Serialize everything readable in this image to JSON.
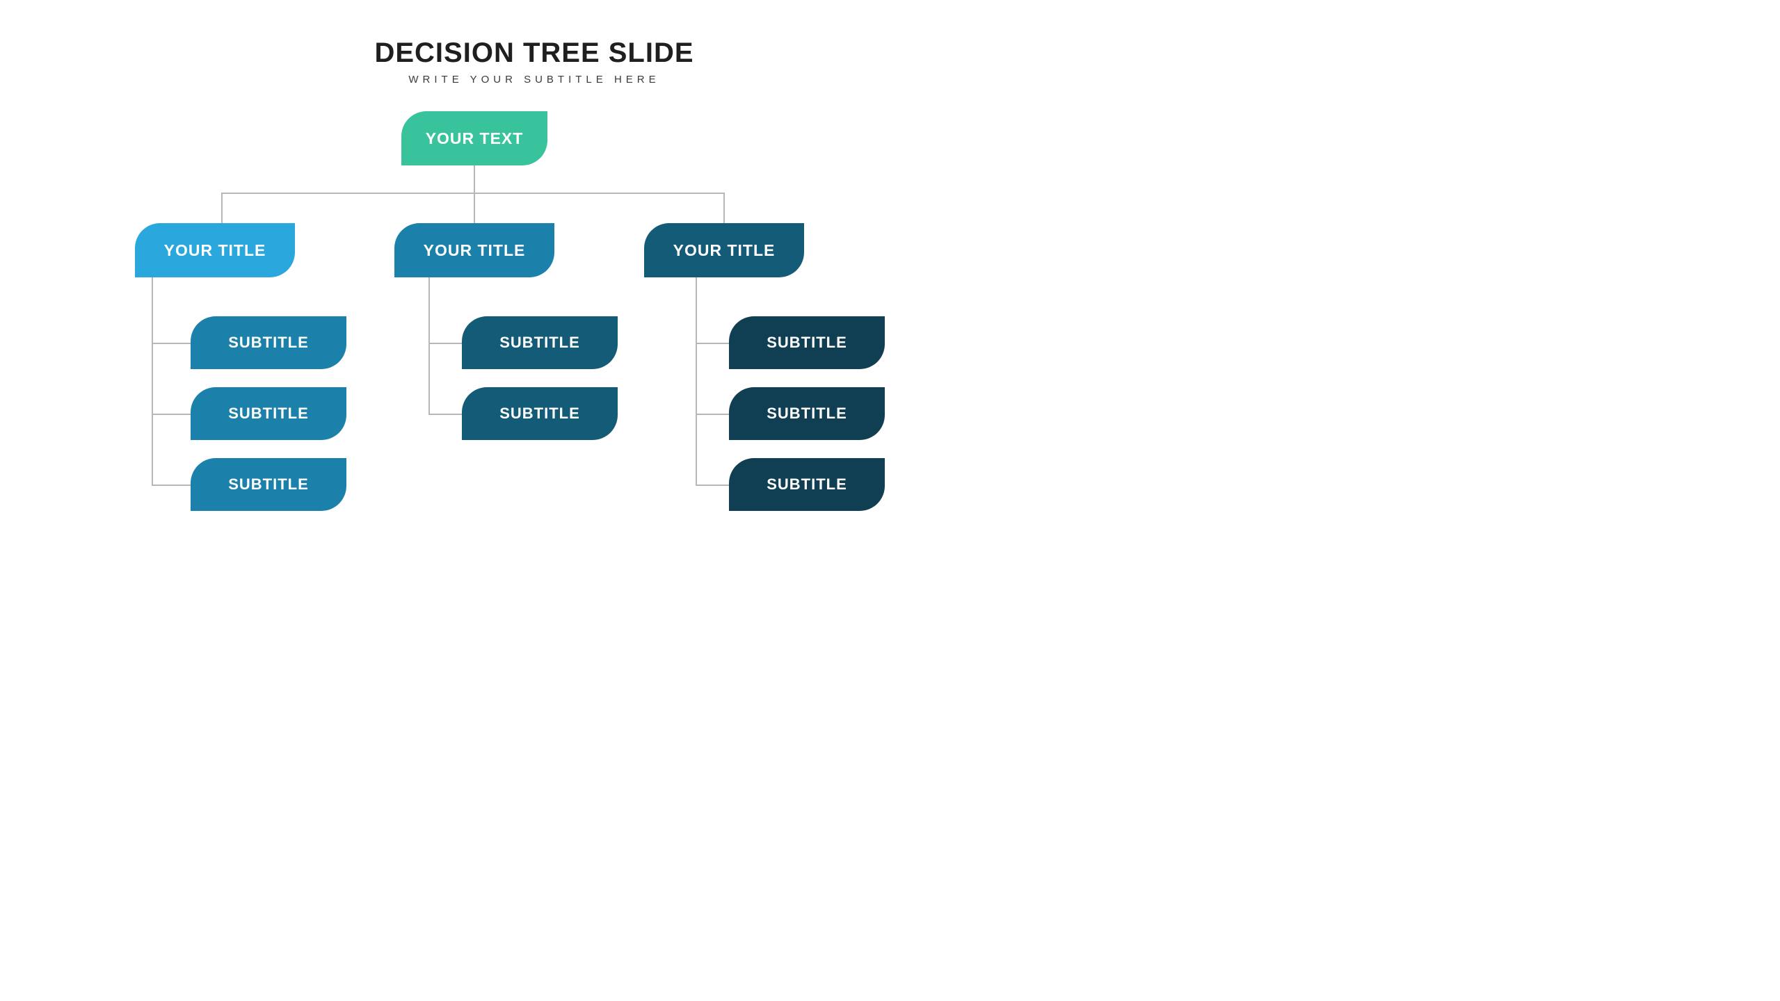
{
  "header": {
    "title": "DECISION TREE SLIDE",
    "subtitle": "WRITE YOUR SUBTITLE HERE"
  },
  "root": {
    "label": "YOUR TEXT",
    "color": "#39c39d"
  },
  "branches": [
    {
      "label": "YOUR TITLE",
      "color": "#2aa8de",
      "leaf_color": "#1b81ab",
      "leaves": [
        "SUBTITLE",
        "SUBTITLE",
        "SUBTITLE"
      ]
    },
    {
      "label": "YOUR TITLE",
      "color": "#1b81ab",
      "leaf_color": "#145b78",
      "leaves": [
        "SUBTITLE",
        "SUBTITLE"
      ]
    },
    {
      "label": "YOUR TITLE",
      "color": "#145b78",
      "leaf_color": "#103f54",
      "leaves": [
        "SUBTITLE",
        "SUBTITLE",
        "SUBTITLE"
      ]
    }
  ]
}
